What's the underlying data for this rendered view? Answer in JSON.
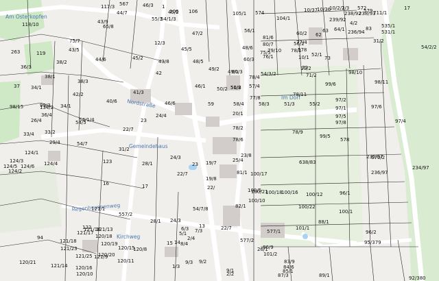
{
  "colors": {
    "background": "#f1efec",
    "meadow": "#cfe8c6",
    "road": "#ffffff",
    "building": "#d2cdca",
    "water": "#a7d3f5",
    "line": "#222222",
    "text": "#111111",
    "place_label": "#4a78b0"
  },
  "place_labels": [
    "Am Osterkopfen",
    "Regenbrunnenweg",
    "Nordstraße",
    "Im Dorf",
    "Gemeindehaus",
    "Kirchweg"
  ],
  "parcels": [
    "117/3",
    "567",
    "44/7",
    "46/3",
    "45/2",
    "1",
    "106",
    "106",
    "105/1",
    "574",
    "104/1",
    "10/37",
    "10/36",
    "10/2/1",
    "2/3",
    "572",
    "579",
    "711/1",
    "17",
    "43/9",
    "65/8",
    "47/2",
    "55/3",
    "54/1/3",
    "56/1",
    "60/2",
    "62",
    "63",
    "64/1",
    "535/1",
    "531/1",
    "118/10",
    "75/7",
    "83",
    "4/2",
    "31/2",
    "12/3",
    "45/5",
    "48/6",
    "56/2",
    "60/3",
    "50/2",
    "54/2/2",
    "263",
    "119",
    "38/2",
    "43/5",
    "45/2",
    "44/6",
    "43/8",
    "48/5",
    "52/1",
    "73",
    "99/3",
    "34/1",
    "36/3",
    "38/1",
    "37",
    "36/4",
    "38/3",
    "42/2",
    "40/6",
    "41/3",
    "42",
    "46/6",
    "46/1",
    "49/2",
    "49/1",
    "50/2",
    "51/8",
    "54/3/2",
    "57/4",
    "78/4",
    "77/8",
    "78/11",
    "99/6",
    "98/10",
    "98/11",
    "98/15",
    "134/2",
    "34/1",
    "54/1/4",
    "54/5",
    "54/7",
    "29/4",
    "31/2",
    "26/4",
    "33/2",
    "33/4",
    "124/1",
    "124/3",
    "124/5",
    "124/6",
    "124/2",
    "124/4",
    "123",
    "28/1",
    "24/3",
    "23",
    "22/7",
    "22/",
    "19/8",
    "19/7",
    "20/1",
    "78/2",
    "78/6",
    "78/9",
    "99/5",
    "578",
    "97/1",
    "97/2",
    "97/5",
    "97/8",
    "97/6",
    "97/4",
    "670/2",
    "236/97",
    "235/97",
    "234/97",
    "638/83",
    "100/12",
    "100/22",
    "100/21",
    "100/17",
    "100/18",
    "100/16",
    "100/10",
    "100/5",
    "100/1",
    "96/1",
    "96/2",
    "95/379",
    "577/2",
    "577/1",
    "101/1",
    "101/2",
    "89/1",
    "92/380",
    "94",
    "122",
    "121/1",
    "121/9",
    "121/16",
    "121/17",
    "121/18",
    "121/23",
    "121/25",
    "121/14",
    "121/13",
    "120/15",
    "120/18",
    "120/19",
    "120/20",
    "120/11",
    "120/16",
    "120/10",
    "120/8",
    "120/21",
    "557/2",
    "54/7/8",
    "22/7",
    "1/3",
    "9/3",
    "9/2",
    "9/1",
    "2/2",
    "2/4",
    "6/3",
    "7/3",
    "8/4",
    "5/1",
    "15",
    "14",
    "13",
    "16",
    "17",
    "24/3",
    "28/1",
    "22/7",
    "23",
    "24/4",
    "26/1",
    "23/8",
    "25/4",
    "81/1",
    "82/1",
    "86/9",
    "83/9",
    "84/6",
    "85/1",
    "87/3",
    "88/1",
    "238/92",
    "238/93",
    "239/92",
    "236/94",
    "578",
    "10/1",
    "10/2",
    "71/2",
    "72",
    "75/5",
    "76/1",
    "77/4",
    "78/1",
    "79/10",
    "80/7",
    "81/6",
    "60/3",
    "59",
    "58/4",
    "58/3",
    "51/3",
    "55/2"
  ]
}
